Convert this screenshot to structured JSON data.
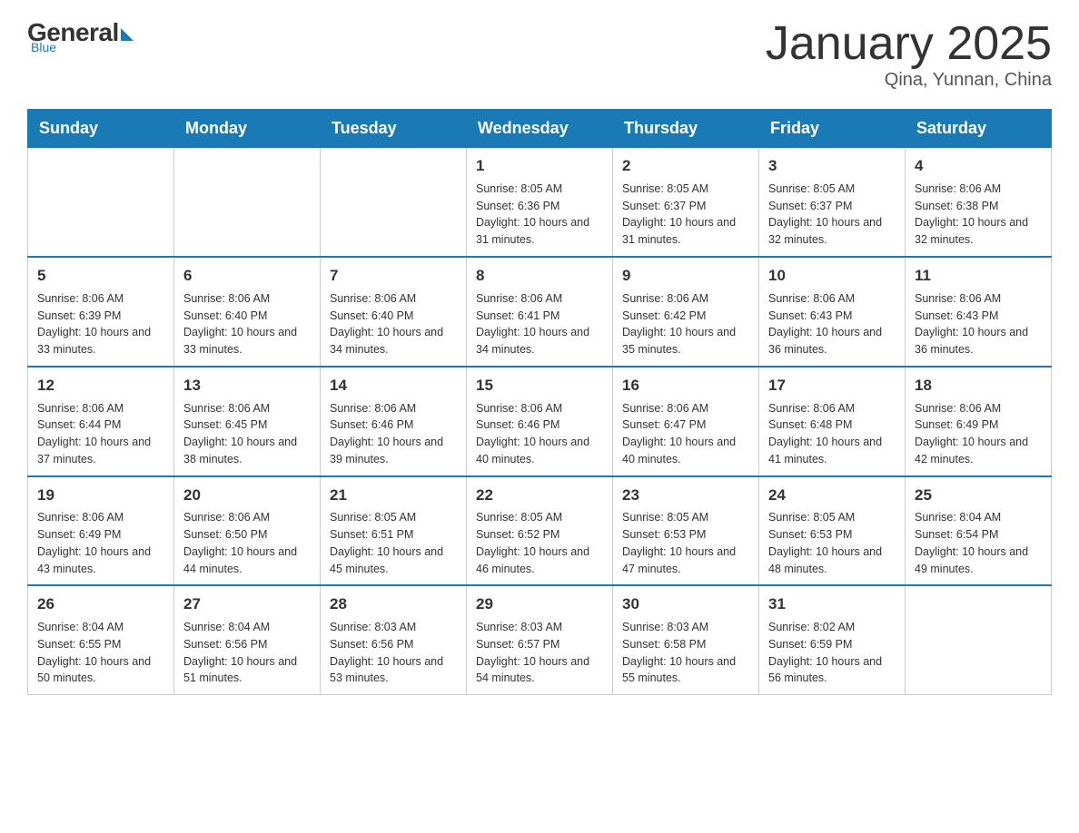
{
  "header": {
    "logo": {
      "general": "General",
      "blue": "Blue",
      "tagline": "Blue"
    },
    "title": "January 2025",
    "location": "Qina, Yunnan, China"
  },
  "weekdays": [
    "Sunday",
    "Monday",
    "Tuesday",
    "Wednesday",
    "Thursday",
    "Friday",
    "Saturday"
  ],
  "weeks": [
    [
      {
        "day": "",
        "info": ""
      },
      {
        "day": "",
        "info": ""
      },
      {
        "day": "",
        "info": ""
      },
      {
        "day": "1",
        "info": "Sunrise: 8:05 AM\nSunset: 6:36 PM\nDaylight: 10 hours\nand 31 minutes."
      },
      {
        "day": "2",
        "info": "Sunrise: 8:05 AM\nSunset: 6:37 PM\nDaylight: 10 hours\nand 31 minutes."
      },
      {
        "day": "3",
        "info": "Sunrise: 8:05 AM\nSunset: 6:37 PM\nDaylight: 10 hours\nand 32 minutes."
      },
      {
        "day": "4",
        "info": "Sunrise: 8:06 AM\nSunset: 6:38 PM\nDaylight: 10 hours\nand 32 minutes."
      }
    ],
    [
      {
        "day": "5",
        "info": "Sunrise: 8:06 AM\nSunset: 6:39 PM\nDaylight: 10 hours\nand 33 minutes."
      },
      {
        "day": "6",
        "info": "Sunrise: 8:06 AM\nSunset: 6:40 PM\nDaylight: 10 hours\nand 33 minutes."
      },
      {
        "day": "7",
        "info": "Sunrise: 8:06 AM\nSunset: 6:40 PM\nDaylight: 10 hours\nand 34 minutes."
      },
      {
        "day": "8",
        "info": "Sunrise: 8:06 AM\nSunset: 6:41 PM\nDaylight: 10 hours\nand 34 minutes."
      },
      {
        "day": "9",
        "info": "Sunrise: 8:06 AM\nSunset: 6:42 PM\nDaylight: 10 hours\nand 35 minutes."
      },
      {
        "day": "10",
        "info": "Sunrise: 8:06 AM\nSunset: 6:43 PM\nDaylight: 10 hours\nand 36 minutes."
      },
      {
        "day": "11",
        "info": "Sunrise: 8:06 AM\nSunset: 6:43 PM\nDaylight: 10 hours\nand 36 minutes."
      }
    ],
    [
      {
        "day": "12",
        "info": "Sunrise: 8:06 AM\nSunset: 6:44 PM\nDaylight: 10 hours\nand 37 minutes."
      },
      {
        "day": "13",
        "info": "Sunrise: 8:06 AM\nSunset: 6:45 PM\nDaylight: 10 hours\nand 38 minutes."
      },
      {
        "day": "14",
        "info": "Sunrise: 8:06 AM\nSunset: 6:46 PM\nDaylight: 10 hours\nand 39 minutes."
      },
      {
        "day": "15",
        "info": "Sunrise: 8:06 AM\nSunset: 6:46 PM\nDaylight: 10 hours\nand 40 minutes."
      },
      {
        "day": "16",
        "info": "Sunrise: 8:06 AM\nSunset: 6:47 PM\nDaylight: 10 hours\nand 40 minutes."
      },
      {
        "day": "17",
        "info": "Sunrise: 8:06 AM\nSunset: 6:48 PM\nDaylight: 10 hours\nand 41 minutes."
      },
      {
        "day": "18",
        "info": "Sunrise: 8:06 AM\nSunset: 6:49 PM\nDaylight: 10 hours\nand 42 minutes."
      }
    ],
    [
      {
        "day": "19",
        "info": "Sunrise: 8:06 AM\nSunset: 6:49 PM\nDaylight: 10 hours\nand 43 minutes."
      },
      {
        "day": "20",
        "info": "Sunrise: 8:06 AM\nSunset: 6:50 PM\nDaylight: 10 hours\nand 44 minutes."
      },
      {
        "day": "21",
        "info": "Sunrise: 8:05 AM\nSunset: 6:51 PM\nDaylight: 10 hours\nand 45 minutes."
      },
      {
        "day": "22",
        "info": "Sunrise: 8:05 AM\nSunset: 6:52 PM\nDaylight: 10 hours\nand 46 minutes."
      },
      {
        "day": "23",
        "info": "Sunrise: 8:05 AM\nSunset: 6:53 PM\nDaylight: 10 hours\nand 47 minutes."
      },
      {
        "day": "24",
        "info": "Sunrise: 8:05 AM\nSunset: 6:53 PM\nDaylight: 10 hours\nand 48 minutes."
      },
      {
        "day": "25",
        "info": "Sunrise: 8:04 AM\nSunset: 6:54 PM\nDaylight: 10 hours\nand 49 minutes."
      }
    ],
    [
      {
        "day": "26",
        "info": "Sunrise: 8:04 AM\nSunset: 6:55 PM\nDaylight: 10 hours\nand 50 minutes."
      },
      {
        "day": "27",
        "info": "Sunrise: 8:04 AM\nSunset: 6:56 PM\nDaylight: 10 hours\nand 51 minutes."
      },
      {
        "day": "28",
        "info": "Sunrise: 8:03 AM\nSunset: 6:56 PM\nDaylight: 10 hours\nand 53 minutes."
      },
      {
        "day": "29",
        "info": "Sunrise: 8:03 AM\nSunset: 6:57 PM\nDaylight: 10 hours\nand 54 minutes."
      },
      {
        "day": "30",
        "info": "Sunrise: 8:03 AM\nSunset: 6:58 PM\nDaylight: 10 hours\nand 55 minutes."
      },
      {
        "day": "31",
        "info": "Sunrise: 8:02 AM\nSunset: 6:59 PM\nDaylight: 10 hours\nand 56 minutes."
      },
      {
        "day": "",
        "info": ""
      }
    ]
  ]
}
